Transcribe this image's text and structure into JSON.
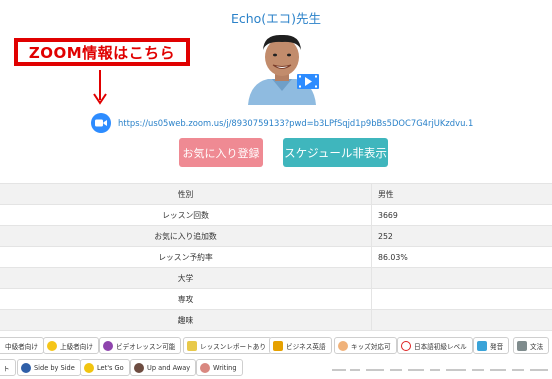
{
  "teacher": {
    "name": "Echo(エコ)先生"
  },
  "callout": {
    "text": "ZOOM情報はこちら"
  },
  "zoom": {
    "link": "https://us05web.zoom.us/j/8930759133?pwd=b3LPfSqjd1p9bBs5DOC7G4rjUKzdvu.1"
  },
  "buttons": {
    "favorite": "お気に入り登録",
    "schedule": "スケジュール非表示"
  },
  "profile": {
    "rows": [
      {
        "label": "性別",
        "value": "男性"
      },
      {
        "label": "レッスン回数",
        "value": "3669"
      },
      {
        "label": "お気に入り追加数",
        "value": "252"
      },
      {
        "label": "レッスン予約率",
        "value": "86.03%"
      },
      {
        "label": "大学",
        "value": ""
      },
      {
        "label": "専攻",
        "value": ""
      },
      {
        "label": "趣味",
        "value": ""
      }
    ]
  },
  "tags": {
    "row1": [
      "中級者向け",
      "上級者向け",
      "ビデオレッスン可能",
      "レッスンレポートあり",
      "ビジネス英語",
      "キッズ対応可",
      "日本語初級レベル",
      "発音",
      "文法"
    ],
    "row2": [
      "ト",
      "Side by Side",
      "Let's Go",
      "Up and Away",
      "Writing"
    ]
  },
  "colors": {
    "link": "#2b82c9",
    "callout": "#e00000",
    "favorite_button": "#ef8a93",
    "schedule_button": "#3fb6bd",
    "zoom_icon": "#2d8cff"
  }
}
